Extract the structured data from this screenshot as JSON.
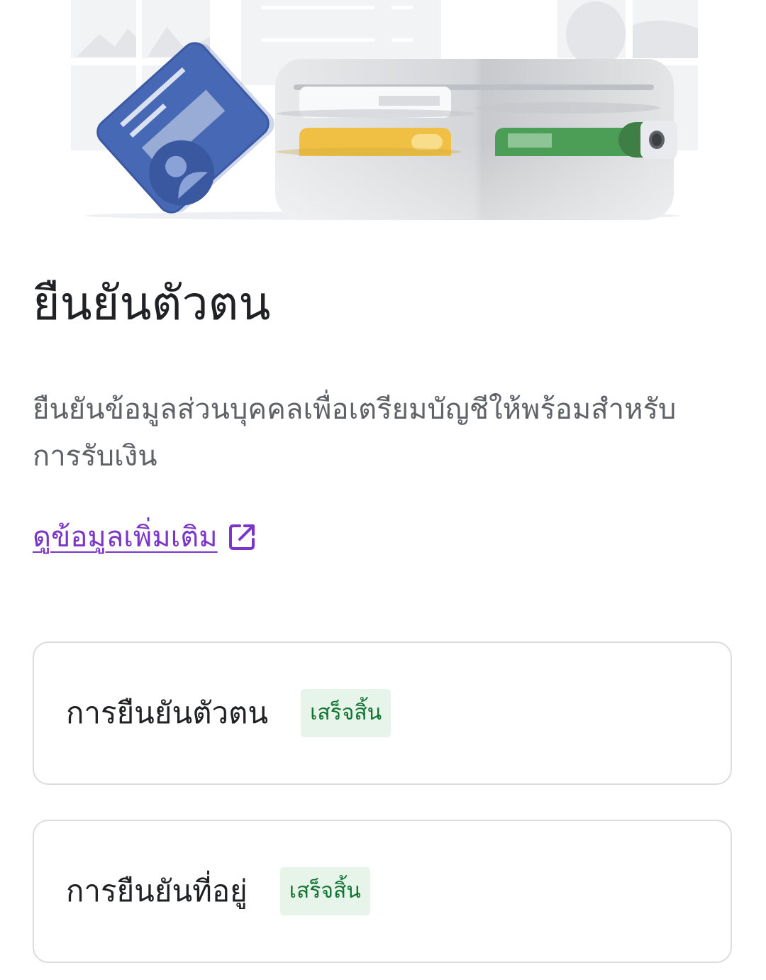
{
  "header": {
    "title": "ยืนยันตัวตน",
    "description": "ยืนยันข้อมูลส่วนบุคคลเพื่อเตรียมบัญชีให้พร้อมสำหรับการรับเงิน",
    "learn_more_label": "ดูข้อมูลเพิ่มเติม",
    "learn_more_icon": "open-in-new-icon",
    "illustration": "id-card-and-wallet-illustration"
  },
  "verification_items": [
    {
      "label": "การยืนยันตัวตน",
      "status": "เสร็จสิ้น"
    },
    {
      "label": "การยืนยันที่อยู่",
      "status": "เสร็จสิ้น"
    }
  ],
  "colors": {
    "link": "#7b35c7",
    "status_text": "#137333",
    "status_background": "#e6f4ea",
    "card_border": "#dadce0",
    "id_card": "#4668b5",
    "wallet_yellow_card": "#f0c045",
    "wallet_green_card": "#4c9d55"
  }
}
